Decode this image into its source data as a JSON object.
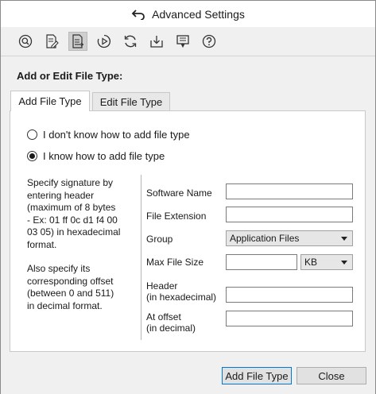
{
  "window": {
    "title": "Advanced Settings"
  },
  "toolbar": {
    "buttons": [
      {
        "icon": "search-icon"
      },
      {
        "icon": "edit-document-icon"
      },
      {
        "icon": "file-type-icon",
        "active": true
      },
      {
        "icon": "play-icon"
      },
      {
        "icon": "refresh-icon"
      },
      {
        "icon": "download-icon"
      },
      {
        "icon": "flag-icon"
      },
      {
        "icon": "help-icon"
      }
    ]
  },
  "section": {
    "title": "Add or Edit File Type:"
  },
  "tabs": [
    {
      "label": "Add File Type",
      "active": true
    },
    {
      "label": "Edit File Type",
      "active": false
    }
  ],
  "options": {
    "unknown": {
      "label": "I don't know how to add file type",
      "checked": false
    },
    "known": {
      "label": "I know how to add file type",
      "checked": true
    }
  },
  "help": {
    "para1": "Specify signature by entering header (maximum of 8 bytes - Ex: 01 ff 0c d1 f4 00 03 05) in hexadecimal format.",
    "para2": "Also specify its corresponding offset (between 0 and 511) in decimal format."
  },
  "form": {
    "software_name": {
      "label": "Software Name",
      "value": ""
    },
    "file_extension": {
      "label": "File Extension",
      "value": ""
    },
    "group": {
      "label": "Group",
      "selected": "Application Files"
    },
    "max_file_size": {
      "label": "Max File Size",
      "value": "",
      "unit": "KB"
    },
    "header": {
      "label_line1": "Header",
      "label_line2": "(in hexadecimal)",
      "value": ""
    },
    "offset": {
      "label_line1": "At offset",
      "label_line2": "(in decimal)",
      "value": ""
    }
  },
  "actions": {
    "add_label": "Add File Type",
    "close_label": "Close"
  }
}
